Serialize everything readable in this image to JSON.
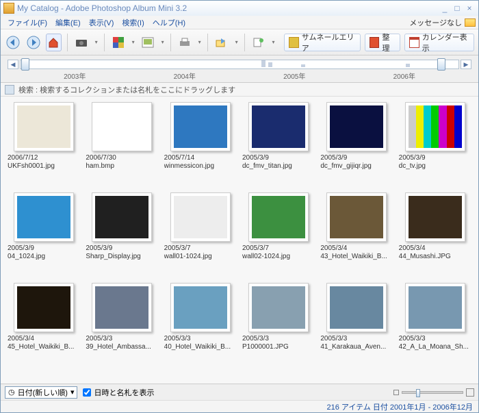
{
  "titlebar": {
    "title": "My Catalog - Adobe Photoshop Album Mini 3.2"
  },
  "menu": {
    "file": "ファイル(F)",
    "edit": "編集(E)",
    "view": "表示(V)",
    "find": "検索(I)",
    "help": "ヘルプ(H)",
    "message": "メッセージなし"
  },
  "toolbar": {
    "thumbArea": "サムネールエリア",
    "organize": "整理",
    "calendar": "カレンダー表示"
  },
  "timeline": {
    "years": [
      "2003年",
      "2004年",
      "2005年",
      "2006年"
    ]
  },
  "search": {
    "label": "検索 : 検索するコレクションまたは名札をここにドラッグします"
  },
  "thumbs": [
    {
      "date": "2006/7/12",
      "name": "UKFsh0001.jpg",
      "c": "#ECE7D8"
    },
    {
      "date": "2006/7/30",
      "name": "ham.bmp",
      "c": "#FFFFFF"
    },
    {
      "date": "2005/7/14",
      "name": "winmessicon.jpg",
      "c": "#2E78C0"
    },
    {
      "date": "2005/3/9",
      "name": "dc_fmv_titan.jpg",
      "c": "#1A2C6E"
    },
    {
      "date": "2005/3/9",
      "name": "dc_fmv_gijiqr.jpg",
      "c": "#0A1040"
    },
    {
      "date": "2005/3/9",
      "name": "dc_tv.jpg",
      "c": "#000000"
    },
    {
      "date": "2005/3/9",
      "name": "04_1024.jpg",
      "c": "#2E90D0"
    },
    {
      "date": "2005/3/9",
      "name": "Sharp_Display.jpg",
      "c": "#202020"
    },
    {
      "date": "2005/3/7",
      "name": "wall01-1024.jpg",
      "c": "#EDEDED"
    },
    {
      "date": "2005/3/7",
      "name": "wall02-1024.jpg",
      "c": "#3C9040"
    },
    {
      "date": "2005/3/4",
      "name": "43_Hotel_Waikiki_B...",
      "c": "#6B5838"
    },
    {
      "date": "2005/3/4",
      "name": "44_Musashi.JPG",
      "c": "#3A2C1C"
    },
    {
      "date": "2005/3/4",
      "name": "45_Hotel_Waikiki_B...",
      "c": "#1E160C"
    },
    {
      "date": "2005/3/3",
      "name": "39_Hotel_Ambassa...",
      "c": "#6A788E"
    },
    {
      "date": "2005/3/3",
      "name": "40_Hotel_Waikiki_B...",
      "c": "#6AA0C0"
    },
    {
      "date": "2005/3/3",
      "name": "P1000001.JPG",
      "c": "#88A0B0"
    },
    {
      "date": "2005/3/3",
      "name": "41_Karakaua_Aven...",
      "c": "#6888A0"
    },
    {
      "date": "2005/3/3",
      "name": "42_A_La_Moana_Sh...",
      "c": "#7898B0"
    }
  ],
  "sortbar": {
    "sort": "日付(新しい順)",
    "showLabel": "日時と名札を表示"
  },
  "status": {
    "text": "216 アイテム 日付 2001年1月 - 2006年12月"
  }
}
